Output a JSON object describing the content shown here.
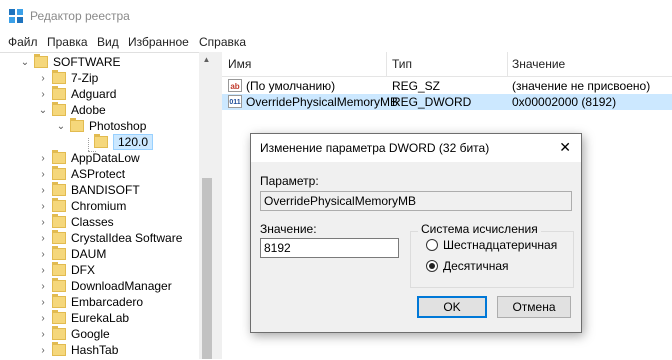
{
  "window": {
    "title": "Редактор реестра"
  },
  "menu": [
    "Файл",
    "Правка",
    "Вид",
    "Избранное",
    "Справка"
  ],
  "tree": [
    {
      "label": "SOFTWARE",
      "expanded": true
    },
    {
      "label": "7-Zip"
    },
    {
      "label": "Adguard"
    },
    {
      "label": "Adobe",
      "expanded": true
    },
    {
      "label": "Photoshop",
      "expanded": true
    },
    {
      "label": "120.0",
      "selected": true
    },
    {
      "label": "AppDataLow"
    },
    {
      "label": "ASProtect"
    },
    {
      "label": "BANDISOFT"
    },
    {
      "label": "Chromium"
    },
    {
      "label": "Classes"
    },
    {
      "label": "CrystalIdea Software"
    },
    {
      "label": "DAUM"
    },
    {
      "label": "DFX"
    },
    {
      "label": "DownloadManager"
    },
    {
      "label": "Embarcadero"
    },
    {
      "label": "EurekaLab"
    },
    {
      "label": "Google"
    },
    {
      "label": "HashTab"
    }
  ],
  "list": {
    "columns": [
      "Имя",
      "Тип",
      "Значение"
    ],
    "rows": [
      {
        "icon": "string-value-icon",
        "icon_text": "ab",
        "name": "(По умолчанию)",
        "type": "REG_SZ",
        "value": "(значение не присвоено)"
      },
      {
        "icon": "dword-value-icon",
        "icon_text": "011",
        "name": "OverridePhysicalMemoryMB",
        "type": "REG_DWORD",
        "value": "0x00002000 (8192)",
        "selected": true
      }
    ]
  },
  "dialog": {
    "title": "Изменение параметра DWORD (32 бита)",
    "param_label": "Параметр:",
    "param_value": "OverridePhysicalMemoryMB",
    "value_label": "Значение:",
    "value": "8192",
    "base_group_label": "Система исчисления",
    "base_options": [
      {
        "label": "Шестнадцатеричная",
        "checked": false
      },
      {
        "label": "Десятичная",
        "checked": true
      }
    ],
    "ok_label": "OK",
    "cancel_label": "Отмена"
  },
  "colors": {
    "selection": "#cce8ff",
    "accent": "#0078d7",
    "folder": "#f5d77b"
  }
}
